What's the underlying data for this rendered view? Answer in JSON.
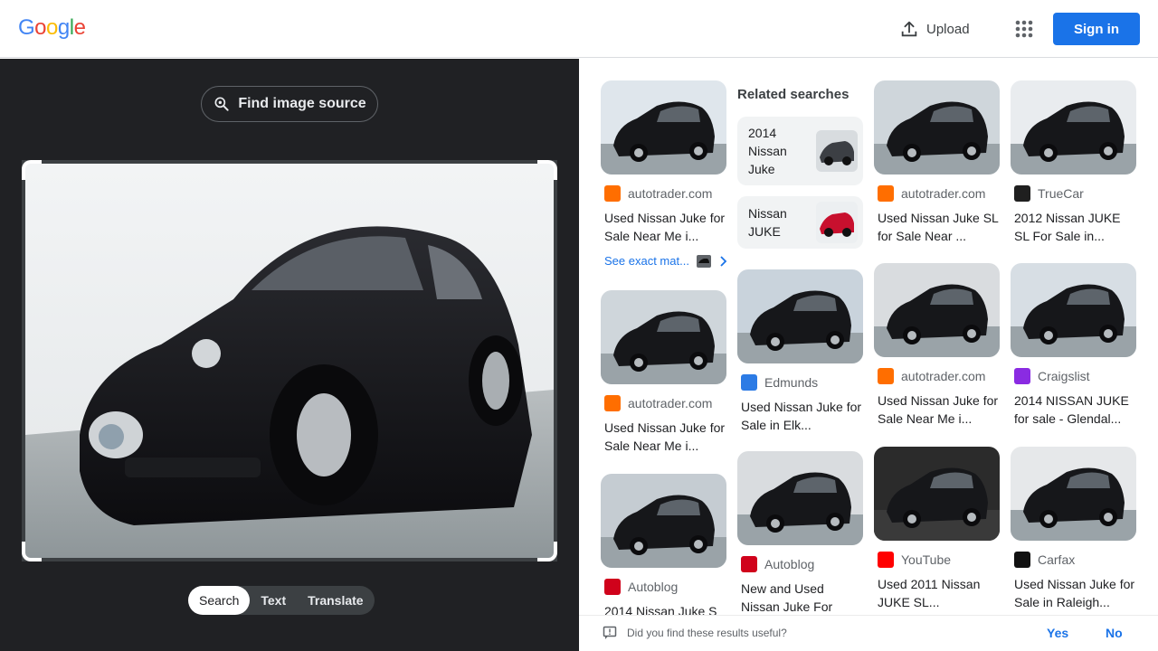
{
  "header": {
    "logo_letters": [
      "G",
      "o",
      "o",
      "g",
      "l",
      "e"
    ],
    "logo_colors": [
      "#4285f4",
      "#ea4335",
      "#fbbc05",
      "#4285f4",
      "#34a853",
      "#ea4335"
    ],
    "upload_label": "Upload",
    "sign_in_label": "Sign in",
    "apps_icon": "apps-grid-icon"
  },
  "lens": {
    "find_source_label": "Find image source",
    "tabs": [
      {
        "label": "Search",
        "active": true
      },
      {
        "label": "Text",
        "active": false
      },
      {
        "label": "Translate",
        "active": false
      }
    ]
  },
  "results": {
    "related_title": "Related searches",
    "related": [
      {
        "label": "2014 Nissan Juke",
        "car_color": "#3c3f44"
      },
      {
        "label": "Nissan JUKE",
        "car_color": "#c8102e"
      }
    ],
    "see_exact_label": "See exact mat...",
    "cards": [
      {
        "source": "autotrader.com",
        "title": "Used Nissan Juke for Sale Near Me i...",
        "favicon": "autotrader-icon",
        "fav_color": "#ff6e00",
        "bg": "#dfe6ec"
      },
      {
        "source": "autotrader.com",
        "title": "Used Nissan Juke SL for Sale Near ...",
        "favicon": "autotrader-icon",
        "fav_color": "#ff6e00",
        "bg": "#cfd6db"
      },
      {
        "source": "TrueCar",
        "title": "2012 Nissan JUKE SL For Sale in...",
        "favicon": "truecar-icon",
        "fav_color": "#1f1f1f",
        "bg": "#e9ecef"
      },
      {
        "source": "autotrader.com",
        "title": "Used Nissan Juke for Sale Near Me i...",
        "favicon": "autotrader-icon",
        "fav_color": "#ff6e00",
        "bg": "#cfd6db"
      },
      {
        "source": "Edmunds",
        "title": "Used Nissan Juke for Sale in Elk...",
        "favicon": "edmunds-icon",
        "fav_color": "#2c7be5",
        "bg": "#c9d3dc"
      },
      {
        "source": "autotrader.com",
        "title": "Used Nissan Juke for Sale Near Me i...",
        "favicon": "autotrader-icon",
        "fav_color": "#ff6e00",
        "bg": "#d9dcdf"
      },
      {
        "source": "Craigslist",
        "title": "2014 NISSAN JUKE for sale - Glendal...",
        "favicon": "craigslist-icon",
        "fav_color": "#8a2be2",
        "bg": "#d7dee4"
      },
      {
        "source": "Autoblog",
        "title": "2014 Nissan Juke S",
        "favicon": "autoblog-icon",
        "fav_color": "#d0021b",
        "bg": "#c5ccd2"
      },
      {
        "source": "Autoblog",
        "title": "New and Used Nissan Juke For",
        "favicon": "autoblog-icon",
        "fav_color": "#d0021b",
        "bg": "#d9dcdf"
      },
      {
        "source": "YouTube",
        "title": "Used 2011 Nissan JUKE SL...",
        "favicon": "youtube-icon",
        "fav_color": "#ff0000",
        "bg": "#2b2b2b"
      },
      {
        "source": "Carfax",
        "title": "Used Nissan Juke for Sale in Raleigh...",
        "favicon": "carfax-icon",
        "fav_color": "#111111",
        "bg": "#e6e8ea"
      }
    ]
  },
  "feedback": {
    "question": "Did you find these results useful?",
    "yes": "Yes",
    "no": "No"
  }
}
